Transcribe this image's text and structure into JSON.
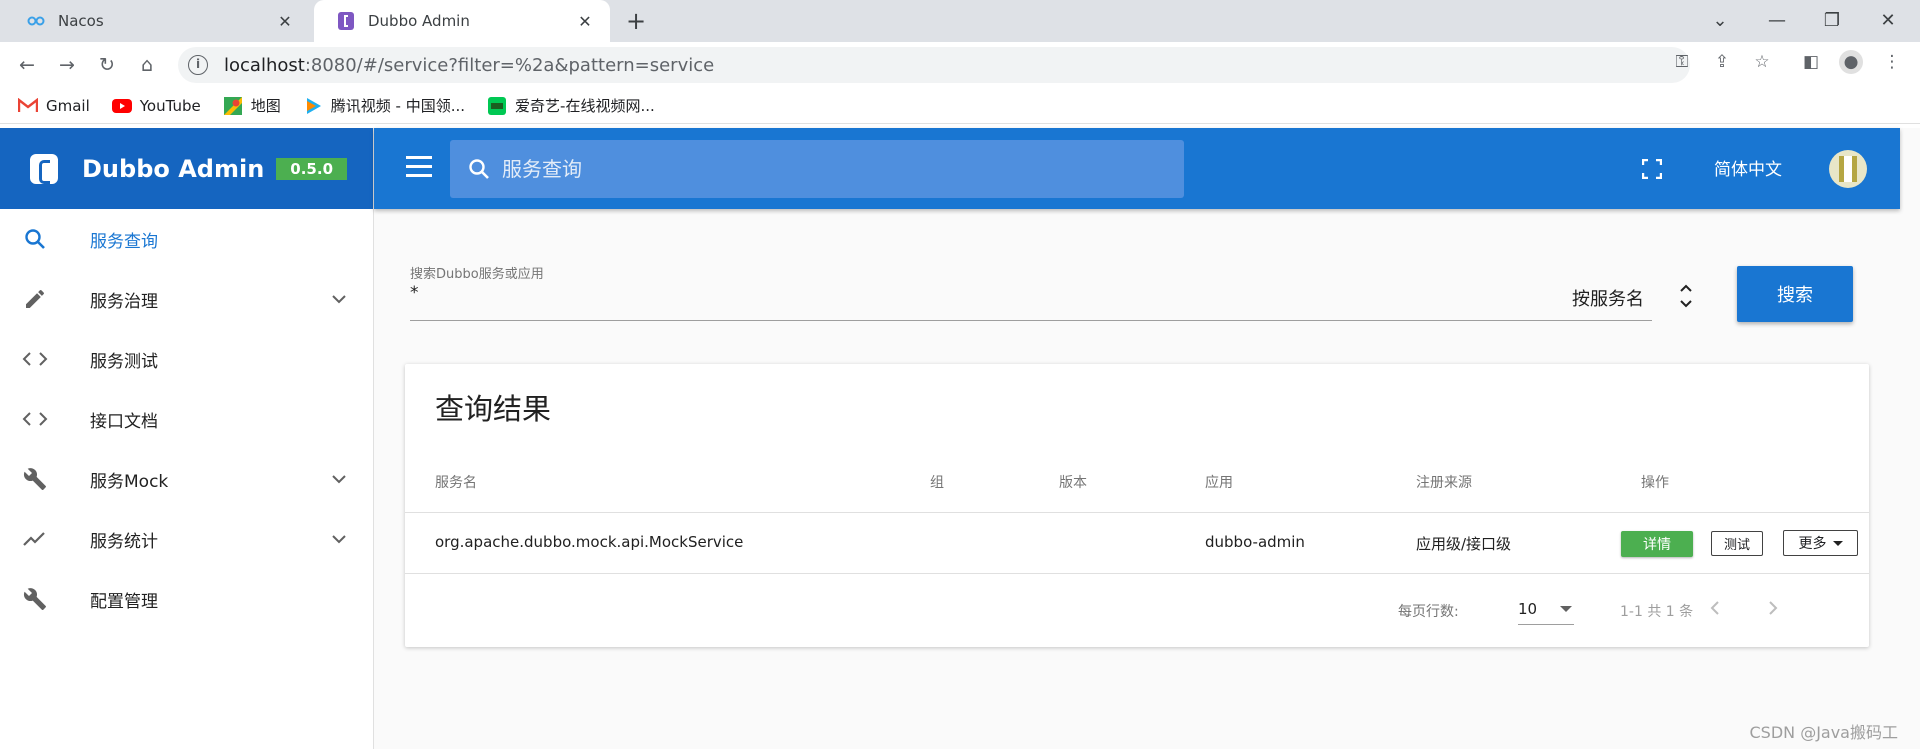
{
  "browser": {
    "tabs": [
      {
        "title": "Nacos",
        "active": false
      },
      {
        "title": "Dubbo Admin",
        "active": true
      }
    ],
    "url": "localhost",
    "url_rest": ":8080/#/service?filter=%2a&pattern=service",
    "bookmarks": [
      {
        "label": "Gmail",
        "icon": "gmail-icon"
      },
      {
        "label": "YouTube",
        "icon": "youtube-icon"
      },
      {
        "label": "地图",
        "icon": "maps-icon"
      },
      {
        "label": "腾讯视频 - 中国领...",
        "icon": "tencent-video-icon"
      },
      {
        "label": "爱奇艺-在线视频网...",
        "icon": "iqiyi-icon"
      }
    ]
  },
  "app": {
    "brand": "Dubbo Admin",
    "version": "0.5.0",
    "search_placeholder": "服务查询",
    "language": "简体中文",
    "accent_color": "#1976d2",
    "sidebar": [
      {
        "label": "服务查询",
        "icon": "search-icon",
        "active": true,
        "expandable": false
      },
      {
        "label": "服务治理",
        "icon": "pencil-icon",
        "active": false,
        "expandable": true
      },
      {
        "label": "服务测试",
        "icon": "code-icon",
        "active": false,
        "expandable": false
      },
      {
        "label": "接口文档",
        "icon": "code-icon",
        "active": false,
        "expandable": false
      },
      {
        "label": "服务Mock",
        "icon": "wrench-icon",
        "active": false,
        "expandable": true
      },
      {
        "label": "服务统计",
        "icon": "trending-icon",
        "active": false,
        "expandable": true
      },
      {
        "label": "配置管理",
        "icon": "wrench-icon",
        "active": false,
        "expandable": false
      }
    ]
  },
  "search": {
    "label": "搜索Dubbo服务或应用",
    "value": "*",
    "type": "按服务名",
    "button": "搜索"
  },
  "results": {
    "title": "查询结果",
    "columns": [
      "服务名",
      "组",
      "版本",
      "应用",
      "注册来源",
      "操作"
    ],
    "rows": [
      {
        "service": "org.apache.dubbo.mock.api.MockService",
        "group": "",
        "version": "",
        "app": "dubbo-admin",
        "source": "应用级/接口级"
      }
    ],
    "actions": {
      "detail": "详情",
      "test": "测试",
      "more": "更多"
    },
    "rows_per_page_label": "每页行数:",
    "rows_per_page": "10",
    "range": "1-1 共 1 条"
  },
  "watermark": "CSDN @Java搬码工"
}
